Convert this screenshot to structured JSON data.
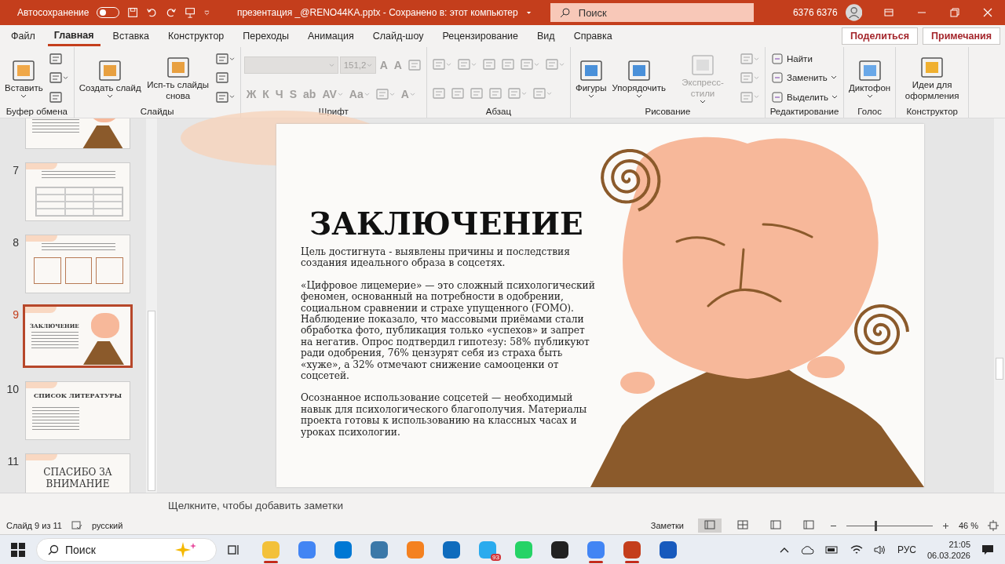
{
  "title_bar": {
    "autosave_label": "Автосохранение",
    "autosave_on": false,
    "document": "презентация _@RENO44KA.pptx - Сохранено в: этот компьютер",
    "search_placeholder": "Поиск",
    "user": "6376 6376"
  },
  "menu": {
    "tabs": [
      {
        "label": "Файл",
        "selected": false
      },
      {
        "label": "Главная",
        "selected": true
      },
      {
        "label": "Вставка",
        "selected": false
      },
      {
        "label": "Конструктор",
        "selected": false
      },
      {
        "label": "Переходы",
        "selected": false
      },
      {
        "label": "Анимация",
        "selected": false
      },
      {
        "label": "Слайд-шоу",
        "selected": false
      },
      {
        "label": "Рецензирование",
        "selected": false
      },
      {
        "label": "Вид",
        "selected": false
      },
      {
        "label": "Справка",
        "selected": false
      }
    ],
    "share": "Поделиться",
    "comments": "Примечания"
  },
  "ribbon": [
    {
      "label": "Буфер обмена",
      "kind": "columns",
      "lines": [
        [
          {
            "kind": "large",
            "label": "Вставить",
            "caret": true,
            "disabled": false
          }
        ],
        [
          {
            "kind": "icon",
            "caret": false,
            "disabled": false
          },
          {
            "kind": "icon",
            "caret": true,
            "disabled": false
          },
          {
            "kind": "icon",
            "caret": false,
            "disabled": false
          }
        ]
      ]
    },
    {
      "label": "Слайды",
      "kind": "columns",
      "lines": [
        [
          {
            "kind": "large",
            "label": "Создать слайд",
            "caret": true,
            "disabled": false
          }
        ],
        [
          {
            "kind": "large",
            "label": "Исп-ть слайды снова",
            "caret": false,
            "disabled": false
          }
        ],
        [
          {
            "kind": "icon",
            "caret": true,
            "disabled": false
          },
          {
            "kind": "icon",
            "caret": false,
            "disabled": false
          },
          {
            "kind": "icon",
            "caret": true,
            "disabled": false
          }
        ]
      ]
    },
    {
      "label": "Шрифт",
      "kind": "rows",
      "lines": [
        [
          {
            "kind": "field",
            "caret": true,
            "disabled": true
          },
          {
            "kind": "field",
            "label": "151,2",
            "caret": true,
            "disabled": true
          },
          {
            "kind": "glyph",
            "label": "A",
            "caret": false,
            "disabled": true
          },
          {
            "kind": "glyph",
            "label": "A",
            "caret": false,
            "disabled": true
          },
          {
            "kind": "icon",
            "caret": false,
            "disabled": true
          }
        ],
        [
          {
            "kind": "glyph",
            "label": "Ж",
            "caret": false,
            "disabled": true
          },
          {
            "kind": "glyph",
            "label": "К",
            "caret": false,
            "disabled": true
          },
          {
            "kind": "glyph",
            "label": "Ч",
            "caret": false,
            "disabled": true
          },
          {
            "kind": "glyph",
            "label": "S",
            "caret": false,
            "disabled": true
          },
          {
            "kind": "glyph",
            "label": "ab",
            "caret": false,
            "disabled": true
          },
          {
            "kind": "glyph",
            "label": "AV",
            "caret": true,
            "disabled": true
          },
          {
            "kind": "glyph",
            "label": "Aa",
            "caret": true,
            "disabled": true
          },
          {
            "kind": "icon",
            "caret": true,
            "disabled": true
          },
          {
            "kind": "glyph",
            "label": "A",
            "caret": true,
            "disabled": true
          }
        ]
      ]
    },
    {
      "label": "Абзац",
      "kind": "rows",
      "lines": [
        [
          {
            "kind": "icon",
            "caret": true,
            "disabled": true
          },
          {
            "kind": "icon",
            "caret": true,
            "disabled": true
          },
          {
            "kind": "icon",
            "caret": false,
            "disabled": true
          },
          {
            "kind": "icon",
            "caret": false,
            "disabled": true
          },
          {
            "kind": "icon",
            "caret": true,
            "disabled": true
          },
          {
            "kind": "icon",
            "caret": true,
            "disabled": true
          }
        ],
        [
          {
            "kind": "icon",
            "caret": false,
            "disabled": true
          },
          {
            "kind": "icon",
            "caret": false,
            "disabled": true
          },
          {
            "kind": "icon",
            "caret": false,
            "disabled": true
          },
          {
            "kind": "icon",
            "caret": false,
            "disabled": true
          },
          {
            "kind": "icon",
            "caret": true,
            "disabled": true
          },
          {
            "kind": "icon",
            "caret": true,
            "disabled": true
          }
        ]
      ]
    },
    {
      "label": "Рисование",
      "kind": "columns",
      "lines": [
        [
          {
            "kind": "large",
            "label": "Фигуры",
            "caret": true,
            "disabled": false
          }
        ],
        [
          {
            "kind": "large",
            "label": "Упорядочить",
            "caret": true,
            "disabled": false
          }
        ],
        [
          {
            "kind": "large",
            "label": "Экспресс-стили",
            "caret": true,
            "disabled": true
          }
        ],
        [
          {
            "kind": "icon",
            "caret": true,
            "disabled": true
          },
          {
            "kind": "icon",
            "caret": true,
            "disabled": true
          },
          {
            "kind": "icon",
            "caret": true,
            "disabled": true
          }
        ]
      ]
    },
    {
      "label": "Редактирование",
      "kind": "columns",
      "lines": [
        [
          {
            "kind": "small",
            "label": "Найти",
            "caret": false,
            "disabled": false
          },
          {
            "kind": "small",
            "label": "Заменить",
            "caret": true,
            "disabled": false
          },
          {
            "kind": "small",
            "label": "Выделить",
            "caret": true,
            "disabled": false
          }
        ]
      ]
    },
    {
      "label": "Голос",
      "kind": "columns",
      "lines": [
        [
          {
            "kind": "large",
            "label": "Диктофон",
            "caret": true,
            "disabled": false
          }
        ]
      ]
    },
    {
      "label": "Конструктор",
      "kind": "columns",
      "lines": [
        [
          {
            "kind": "large",
            "label": "Идеи для оформления",
            "caret": false,
            "disabled": false
          }
        ]
      ]
    }
  ],
  "thumbnails": [
    {
      "kind": "illustration",
      "selected": false
    },
    {
      "number": "7",
      "kind": "table",
      "selected": false
    },
    {
      "number": "8",
      "kind": "cards",
      "selected": false
    },
    {
      "number": "9",
      "kind": "illustration",
      "title": "ЗАКЛЮЧЕНИЕ",
      "selected": true
    },
    {
      "number": "10",
      "kind": "list",
      "title": "СПИСОК ЛИТЕРАТУРЫ",
      "selected": false
    },
    {
      "number": "11",
      "kind": "title",
      "title": "СПАСИБО ЗА ВНИМАНИЕ",
      "selected": false
    }
  ],
  "slide": {
    "title": "ЗАКЛЮЧЕНИЕ",
    "paragraphs": [
      "Цель достигнута - выявлены причины и последствия создания идеального образа в соцсетях.",
      "«Цифровое лицемерие» — это сложный психологический феномен, основанный на потребности в одобрении, социальном сравнении и страхе упущенного (FOMO). Наблюдение показало, что массовыми приёмами стали обработка фото, публикация только «успехов» и запрет на негатив. Опрос подтвердил гипотезу: 58% публикуют ради одобрения, 76% цензурят себя из страха быть «хуже», а 32% отмечают снижение самооценки от соцсетей.",
      "Осознанное использование соцсетей — необходимый навык для психологического благополучия. Материалы проекта готовы к использованию на классных часах и уроках психологии."
    ]
  },
  "notes_placeholder": "Щелкните, чтобы добавить заметки",
  "status_bar": {
    "slide_counter": "Слайд 9 из 11",
    "language": "русский",
    "notes": "Заметки",
    "views": [
      {
        "selected": true
      },
      {
        "selected": false
      },
      {
        "selected": false
      },
      {
        "selected": false
      }
    ],
    "zoom_slider": {
      "level": 0.33
    },
    "zoom": "46 %"
  },
  "taskbar": {
    "search_placeholder": "Поиск",
    "apps": [
      {
        "color": "#f3c13a",
        "running": true
      },
      {
        "color": "#4285f4",
        "running": false
      },
      {
        "color": "#0078d4",
        "running": false
      },
      {
        "color": "#3b78a8",
        "running": false
      },
      {
        "color": "#f48120",
        "running": false
      },
      {
        "color": "#0f6cbd",
        "running": false
      },
      {
        "color": "#2aabee",
        "running": false,
        "badge": "93"
      },
      {
        "color": "#25d366",
        "running": false
      },
      {
        "color": "#222222",
        "running": false
      },
      {
        "color": "#4285f4",
        "running": true
      },
      {
        "color": "#c43e1c",
        "running": true
      },
      {
        "color": "#185abd",
        "running": false
      }
    ],
    "language": "РУС",
    "time": "21:05",
    "date": "06.03.2026"
  }
}
